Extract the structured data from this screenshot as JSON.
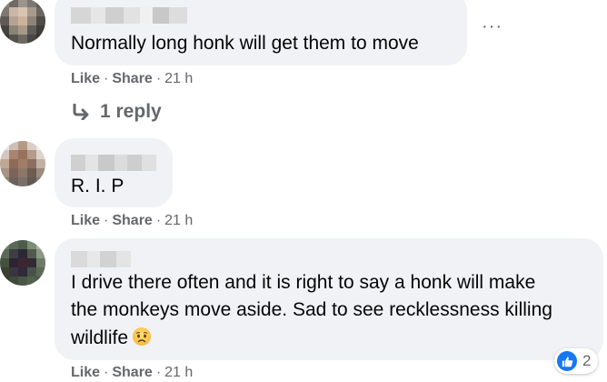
{
  "comments": [
    {
      "text_lines": [
        "Normally long honk will get them to move"
      ],
      "actions": {
        "like": "Like",
        "share": "Share",
        "sep": "·",
        "time": "21 h"
      },
      "reply_link": "1 reply"
    },
    {
      "text_lines": [
        "R. I. P"
      ],
      "actions": {
        "like": "Like",
        "share": "Share",
        "sep": "·",
        "time": "21 h"
      }
    },
    {
      "text_lines": [
        "I drive there often and it is right to say a honk will make",
        "the monkeys move aside. Sad to see recklessness killing",
        "wildlife"
      ],
      "emoji": "sad-face-emoji",
      "actions": {
        "like": "Like",
        "share": "Share",
        "sep": "·",
        "time": "21 h"
      },
      "reactions": {
        "icon": "thumbs-up-icon",
        "count": "2"
      }
    }
  ],
  "more_options": "···",
  "colors": {
    "bubble": "#f0f2f5",
    "secondary_text": "#65676b",
    "like_blue": "#1877f2"
  }
}
